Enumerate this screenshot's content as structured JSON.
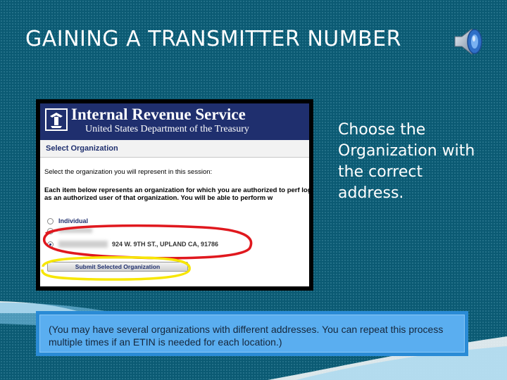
{
  "slide": {
    "title": "GAINING A TRANSMITTER NUMBER",
    "side_text": "Choose the Organization with the correct address.",
    "note": "(You may have several organizations with different addresses.  You can repeat this process multiple times if an ETIN is needed for each location.)"
  },
  "screenshot": {
    "header_title": "Internal Revenue Service",
    "header_subtitle": "United States Department of the Treasury",
    "section_title": "Select Organization",
    "prompt": "Select the organization you will represent in this session:",
    "description": "Each item below represents an organization for which you are authorized to perf logging in as an authorized user of that organization. You will be able to perform w",
    "options": [
      {
        "label": "Individual",
        "selected": false
      },
      {
        "label": "",
        "selected": false
      },
      {
        "label": "924 W. 9TH ST., UPLAND CA, 91786",
        "selected": true
      }
    ],
    "submit_label": "Submit Selected Organization"
  },
  "colors": {
    "background": "#0b5a73",
    "irs_header": "#1f2f6e",
    "note_box": "#5aaef0",
    "highlight_red": "#e0181e",
    "highlight_yellow": "#f7e600"
  },
  "icons": {
    "speaker": "speaker-icon",
    "irs_logo": "irs-eagle-icon"
  }
}
